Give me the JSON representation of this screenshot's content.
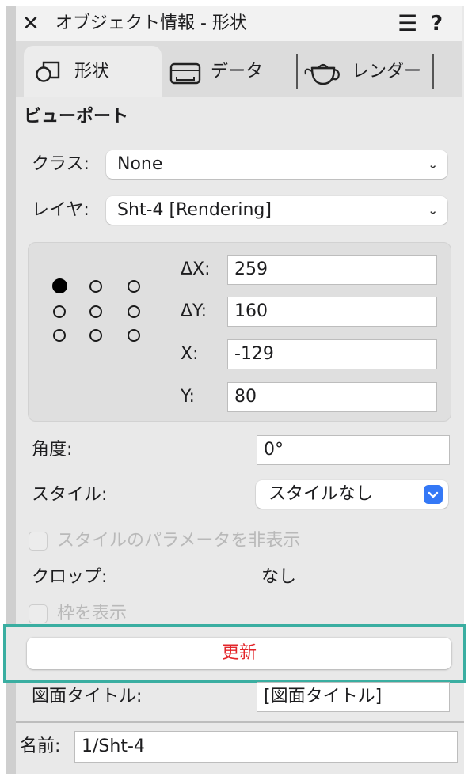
{
  "title_bar": {
    "close_glyph": "✕",
    "title": "オブジェクト情報 - 形状",
    "menu_glyph": "☰",
    "help_glyph": "?"
  },
  "tabs": [
    {
      "label": "形状",
      "icon": "shape-icon",
      "active": true
    },
    {
      "label": "データ",
      "icon": "data-icon",
      "active": false
    },
    {
      "label": "レンダー",
      "icon": "teapot-icon",
      "active": false
    }
  ],
  "section_header": "ビューポート",
  "class_field": {
    "label": "クラス:",
    "value": "None"
  },
  "layer_field": {
    "label": "レイヤ:",
    "value": "Sht-4 [Rendering]"
  },
  "geometry": {
    "delta_x_label": "ΔX:",
    "delta_x": "259",
    "delta_y_label": "ΔY:",
    "delta_y": "160",
    "x_label": "X:",
    "x": "-129",
    "y_label": "Y:",
    "y": "80",
    "selected_anchor": "top-left"
  },
  "angle_field": {
    "label": "角度:",
    "value": "0°"
  },
  "style_field": {
    "label": "スタイル:",
    "value": "スタイルなし"
  },
  "hide_style_params": {
    "label": "スタイルのパラメータを非表示",
    "checked": false,
    "enabled": false
  },
  "crop_field": {
    "label": "クロップ:",
    "value": "なし"
  },
  "show_frame": {
    "label": "枠を表示",
    "checked": false,
    "enabled": false
  },
  "update_button": {
    "label": "更新",
    "color": "#e3262b"
  },
  "drawing_title_field": {
    "label": "図面タイトル:",
    "value": "[図面タイトル]"
  },
  "name_field": {
    "label": "名前:",
    "value": "1/Sht-4"
  },
  "colors": {
    "highlight": "#3aaea1",
    "style_dropdown_accent": "#3478f6"
  }
}
